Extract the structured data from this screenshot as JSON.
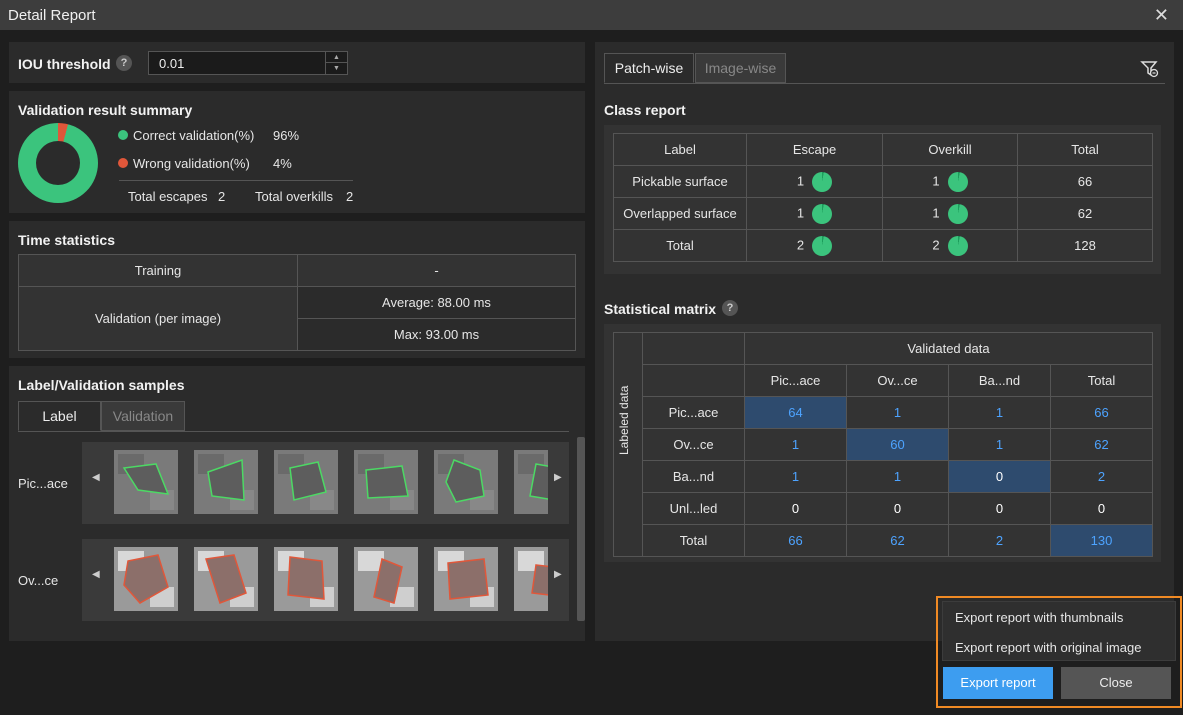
{
  "window": {
    "title": "Detail Report"
  },
  "iou": {
    "label": "IOU threshold",
    "value": "0.01"
  },
  "summary": {
    "title": "Validation result summary",
    "correct_label": "Correct validation(%)",
    "correct_value": "96%",
    "wrong_label": "Wrong validation(%)",
    "wrong_value": "4%",
    "escapes_label": "Total escapes",
    "escapes_value": "2",
    "overkills_label": "Total overkills",
    "overkills_value": "2",
    "correct_fraction": 0.96,
    "colors": {
      "correct": "#3bc47d",
      "wrong": "#e0573a"
    }
  },
  "time": {
    "title": "Time statistics",
    "training_label": "Training",
    "training_value": "-",
    "validation_label": "Validation (per image)",
    "average": "Average: 88.00 ms",
    "max": "Max: 93.00 ms"
  },
  "samples": {
    "title": "Label/Validation samples",
    "tabs": [
      "Label",
      "Validation"
    ],
    "rows": [
      {
        "label": "Pic...ace",
        "outline": "#4cd964"
      },
      {
        "label": "Ov...ce",
        "outline": "#e0573a"
      }
    ]
  },
  "right_tabs": [
    "Patch-wise",
    "Image-wise"
  ],
  "class_report": {
    "title": "Class report",
    "headers": [
      "Label",
      "Escape",
      "Overkill",
      "Total"
    ],
    "rows": [
      {
        "label": "Pickable surface",
        "escape": "1",
        "overkill": "1",
        "total": "66"
      },
      {
        "label": "Overlapped surface",
        "escape": "1",
        "overkill": "1",
        "total": "62"
      },
      {
        "label": "Total",
        "escape": "2",
        "overkill": "2",
        "total": "128"
      }
    ]
  },
  "matrix": {
    "title": "Statistical matrix",
    "top_header": "Validated data",
    "side_header": "Labeled data",
    "cols": [
      "Pic...ace",
      "Ov...ce",
      "Ba...nd",
      "Total"
    ],
    "rows": [
      {
        "label": "Pic...ace",
        "values": [
          "64",
          "1",
          "1",
          "66"
        ]
      },
      {
        "label": "Ov...ce",
        "values": [
          "1",
          "60",
          "1",
          "62"
        ]
      },
      {
        "label": "Ba...nd",
        "values": [
          "1",
          "1",
          "0",
          "2"
        ]
      },
      {
        "label": "Unl...led",
        "values": [
          "0",
          "0",
          "0",
          "0"
        ]
      },
      {
        "label": "Total",
        "values": [
          "66",
          "62",
          "2",
          "130"
        ]
      }
    ]
  },
  "export_menu": {
    "item1": "Export report with thumbnails",
    "item2": "Export report with original image",
    "export_button": "Export report",
    "close_button": "Close"
  },
  "colors": {
    "accent": "#3d9df0",
    "highlight_orange": "#f08a24",
    "matrix_diag": "#2e4b6e"
  }
}
